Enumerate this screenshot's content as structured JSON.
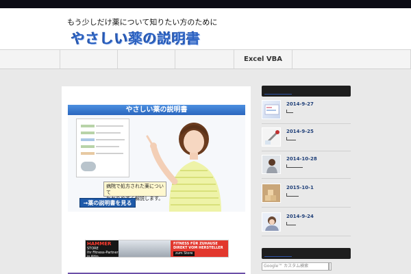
{
  "site": {
    "tagline": "もう少しだけ薬について知りたい方のために",
    "title": "やさしい薬の説明書"
  },
  "nav": {
    "items": [
      "",
      "",
      "",
      "",
      "Excel VBA",
      ""
    ]
  },
  "banner": {
    "title": "やさしい薬の説明書",
    "caption_line1": "病院で処方された薬について",
    "caption_line2": "わかりやすく解説します。",
    "cta": "→薬の説明書を見る"
  },
  "ad": {
    "brand": "HAMMER",
    "store": "STORE",
    "tagline": "Ihr Fitness-Partner in Köln",
    "headline": "FITNESS FÜR ZUHAUSE DIREKT VOM HERSTELLER",
    "button": "zum Store"
  },
  "sidebar": {
    "posts": [
      {
        "date": "2014-9-27",
        "excerpt": "[..."
      },
      {
        "date": "2014-9-25",
        "excerpt": "[......"
      },
      {
        "date": "2014-10-28",
        "excerpt": "[..............."
      },
      {
        "date": "2015-10-1",
        "excerpt": "[1........"
      },
      {
        "date": "2014-9-24",
        "excerpt": "[......"
      }
    ],
    "search_placeholder": "Google™ カスタム検索"
  },
  "colors": {
    "brand_blue": "#2d63c2",
    "date_text": "#1f3f78",
    "sidebar_header": "#1e1e1e"
  }
}
